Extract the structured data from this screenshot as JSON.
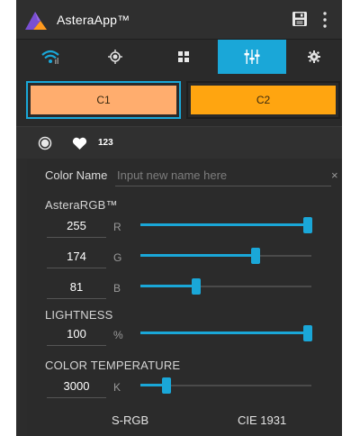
{
  "app": {
    "title": "AsteraApp™"
  },
  "colors": {
    "accent": "#1aa7d8",
    "c1": "#ffad6e",
    "c2": "#ffa510",
    "background": "#2c2c2c"
  },
  "actionbar": {
    "save_icon": "save-icon",
    "overflow_icon": "more-vertical-icon"
  },
  "tabs": [
    {
      "icon": "wifi-signal-icon",
      "active": false
    },
    {
      "icon": "crosshair-icon",
      "active": false
    },
    {
      "icon": "grid-icon",
      "active": false
    },
    {
      "icon": "sliders-icon",
      "active": true
    },
    {
      "icon": "gear-icon",
      "active": false
    }
  ],
  "slots": {
    "c1_label": "C1",
    "c2_label": "C2",
    "selected": "C1"
  },
  "modes": {
    "circle_icon": "color-wheel-icon",
    "heart_icon": "heart-icon",
    "numeric_label": "123"
  },
  "color_name": {
    "label": "Color Name",
    "placeholder": "Input new name here",
    "value": "",
    "clear_label": "×"
  },
  "rgb": {
    "section_label": "AsteraRGB™",
    "max": 255,
    "channels": [
      {
        "channel": "R",
        "value": "255",
        "level": 255
      },
      {
        "channel": "G",
        "value": "174",
        "level": 174
      },
      {
        "channel": "B",
        "value": "81",
        "level": 81
      }
    ]
  },
  "lightness": {
    "section_label": "LIGHTNESS",
    "value": "100",
    "unit": "%",
    "level_percent": 100
  },
  "color_temperature": {
    "section_label": "COLOR TEMPERATURE",
    "value": "3000",
    "unit": "K",
    "level_fraction": 0.14
  },
  "footer": {
    "tab1_label": "S-RGB",
    "tab2_label": "CIE 1931"
  }
}
